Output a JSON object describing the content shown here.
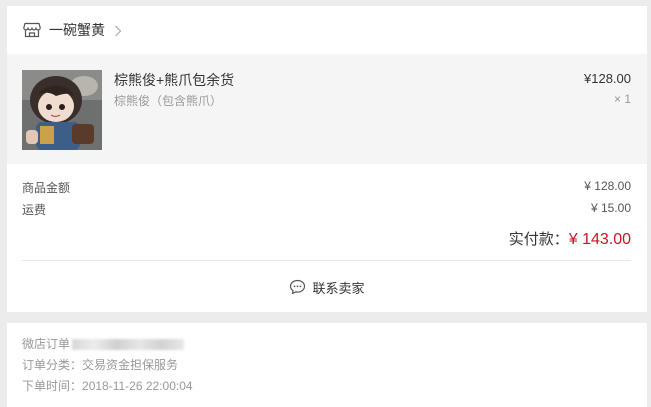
{
  "shop": {
    "name": "一碗蟹黄",
    "icon": "store-icon"
  },
  "product": {
    "title": "棕熊俊+熊爪包余货",
    "spec": "棕熊俊（包含熊爪）",
    "price": "¥128.00",
    "quantity": "× 1",
    "image_icon": "plush-doll-photo"
  },
  "amounts": {
    "goods_label": "商品金额",
    "goods_value": "¥ 128.00",
    "shipping_label": "运费",
    "shipping_value": "¥ 15.00",
    "total_label": "实付款：",
    "total_value": "¥ 143.00"
  },
  "contact": {
    "label": "联系卖家",
    "icon": "chat-bubble-icon"
  },
  "meta": {
    "order_no_label": "微店订单",
    "category_label": "订单分类：",
    "category_value": "交易资金担保服务",
    "time_label": "下单时间：",
    "time_value": "2018-11-26 22:00:04"
  },
  "colors": {
    "accent_price": "#c81623",
    "background": "#ececec",
    "product_bg": "#f5f5f5"
  }
}
